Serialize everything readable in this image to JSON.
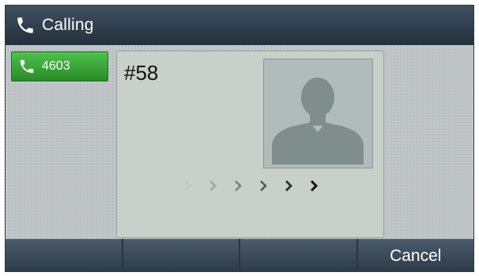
{
  "header": {
    "title": "Calling",
    "icon": "phone-icon"
  },
  "line_key": {
    "label": "4603",
    "icon": "phone-icon",
    "color": "#34a534"
  },
  "call": {
    "number": "#58",
    "avatar": "person-silhouette-icon",
    "status_indicator": "calling-progress-chevrons"
  },
  "softkeys": [
    {
      "label": ""
    },
    {
      "label": ""
    },
    {
      "label": ""
    },
    {
      "label": "Cancel"
    }
  ],
  "colors": {
    "title_bar": "#2e3b48",
    "line_key_green": "#34a534",
    "background": "#bcc1c4"
  }
}
